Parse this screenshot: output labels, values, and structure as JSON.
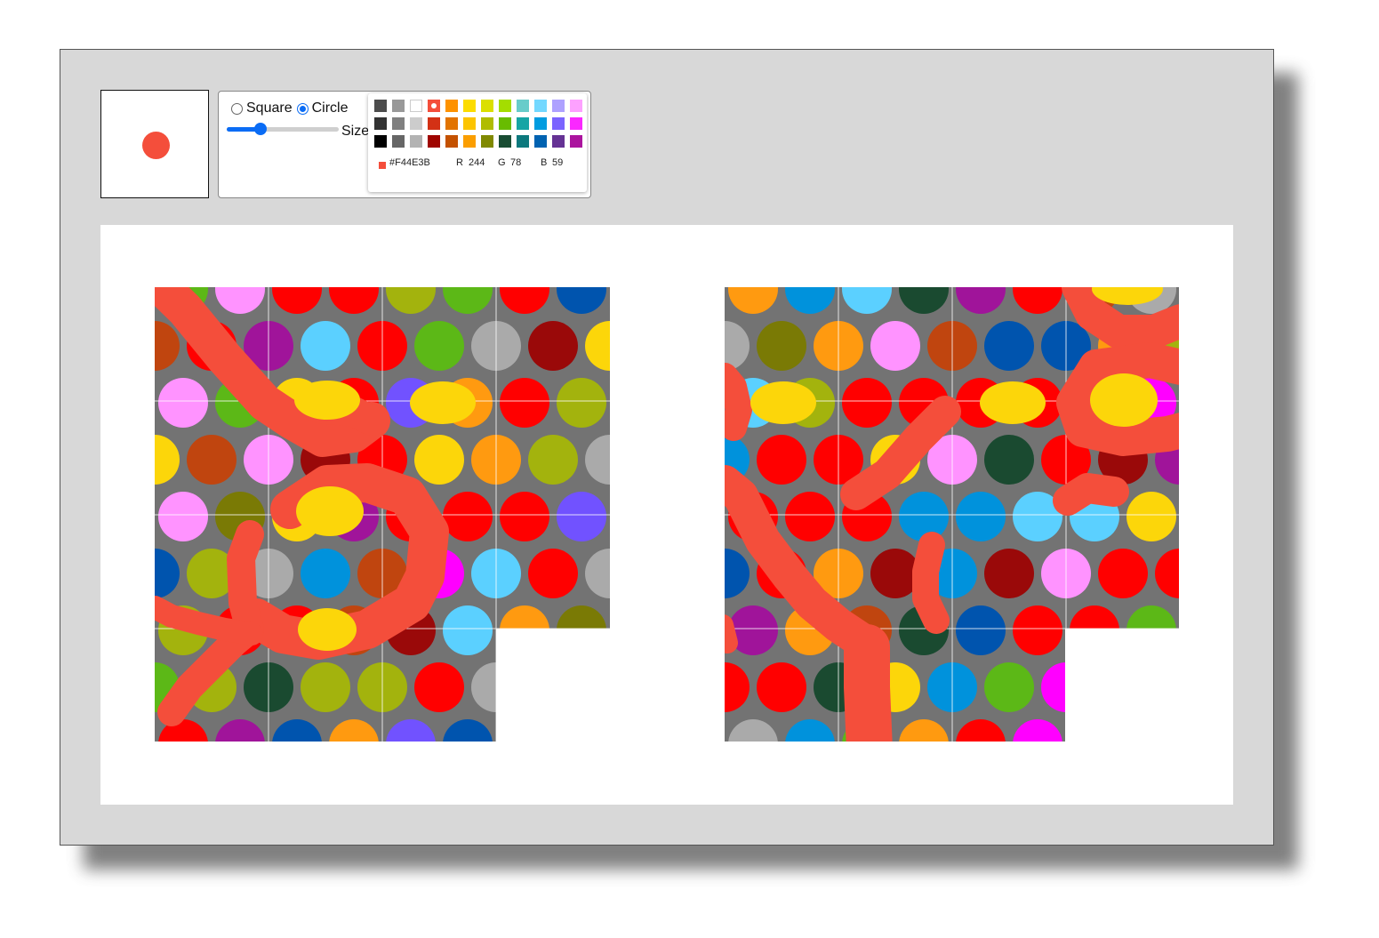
{
  "app": {
    "accent": "#0a6cf5",
    "current_color": "#F44E3B",
    "brush": "circle"
  },
  "toolbar": {
    "shape_options": [
      {
        "label": "Square",
        "selected": false
      },
      {
        "label": "Circle",
        "selected": true
      }
    ],
    "size_label": "Size",
    "size_value_fraction": 0.3
  },
  "palette": {
    "rows": [
      [
        "#4D4D4D",
        "#999999",
        "#FFFFFF",
        "#F44E3B",
        "#FE9200",
        "#FCDC00",
        "#DBDF00",
        "#A4DD00",
        "#68CCCA",
        "#73D8FF",
        "#AEA1FF",
        "#FDA1FF"
      ],
      [
        "#333333",
        "#808080",
        "#CCCCCC",
        "#D33115",
        "#E27300",
        "#FCC400",
        "#B0BC00",
        "#68BC00",
        "#16A5A5",
        "#009CE0",
        "#7B64FF",
        "#FA28FF"
      ],
      [
        "#000000",
        "#666666",
        "#B3B3B3",
        "#9F0500",
        "#C45100",
        "#FB9E00",
        "#808900",
        "#194D33",
        "#0C797D",
        "#0062B1",
        "#653294",
        "#AB149E"
      ]
    ],
    "selected": {
      "row": 0,
      "col": 3
    },
    "hex": "#F44E3B",
    "r_label": "R",
    "r": "244",
    "g_label": "G",
    "g": "78",
    "b_label": "B",
    "b": "59"
  }
}
